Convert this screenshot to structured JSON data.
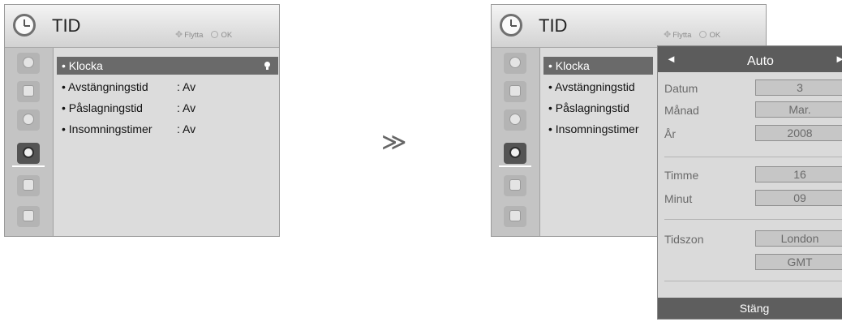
{
  "left_panel": {
    "title": "TID",
    "hint_move": "Flytta",
    "hint_ok": "OK",
    "sidebar_icons": [
      "input-icon",
      "picture-icon",
      "audio-icon",
      "clock-icon",
      "lock-icon",
      "option-icon"
    ],
    "items": [
      {
        "label": "• Klocka",
        "value": ""
      },
      {
        "label": "• Avstängningstid",
        "value": ": Av"
      },
      {
        "label": "• Påslagningstid",
        "value": ": Av"
      },
      {
        "label": "• Insomningstimer",
        "value": ": Av"
      }
    ]
  },
  "separator_glyph": "≫",
  "right_panel": {
    "title": "TID",
    "hint_move": "Flytta",
    "hint_ok": "OK",
    "items": [
      "• Klocka",
      "• Avstängningstid",
      "• Påslagningstid",
      "• Insomningstimer"
    ]
  },
  "clock_popup": {
    "left_arrow": "◄",
    "right_arrow": "►",
    "mode": "Auto",
    "date_label": "Datum",
    "date_value": "3",
    "month_label": "Månad",
    "month_value": "Mar.",
    "year_label": "År",
    "year_value": "2008",
    "hour_label": "Timme",
    "hour_value": "16",
    "minute_label": "Minut",
    "minute_value": "09",
    "timezone_label": "Tidszon",
    "timezone_city": "London",
    "timezone_code": "GMT",
    "close_label": "Stäng"
  }
}
